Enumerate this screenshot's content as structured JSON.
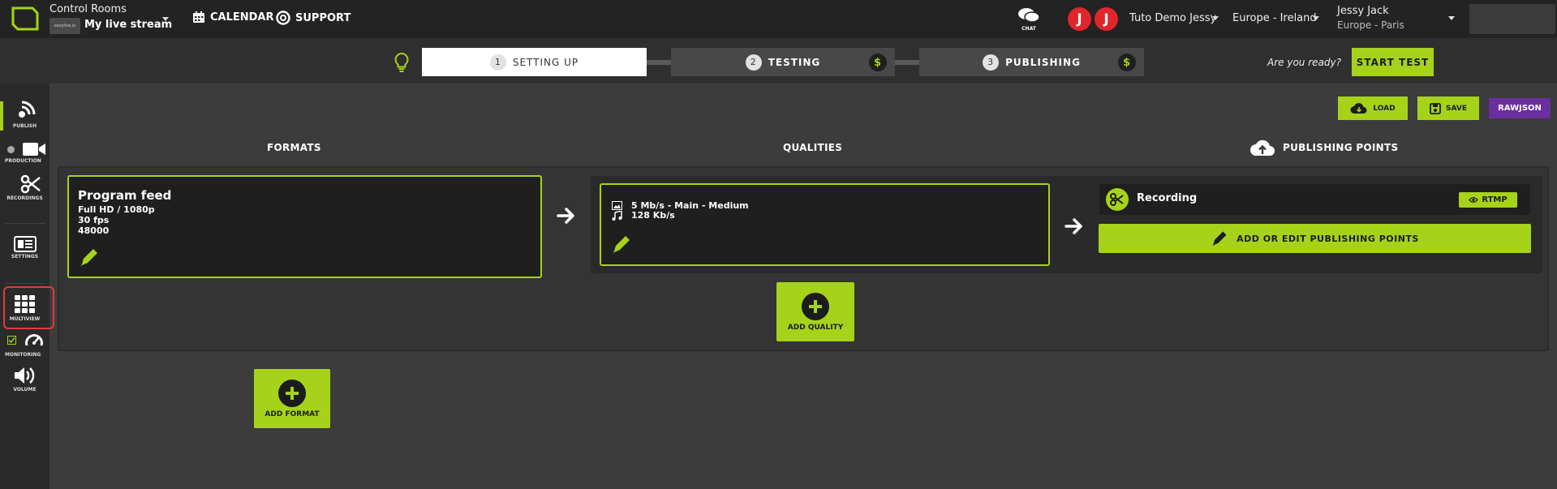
{
  "topbar": {
    "app_title": "Control Rooms",
    "stream_logo_text": "easylive.io",
    "stream_name": "My live stream",
    "calendar": "CALENDAR",
    "support": "SUPPORT",
    "chat": "CHAT",
    "avatar_1": "J",
    "avatar_2": "J",
    "workspace": "Tuto Demo Jessy",
    "region": "Europe - Ireland",
    "user_name": "Jessy Jack",
    "user_location": "Europe - Paris"
  },
  "steps": [
    {
      "num": "1",
      "label": "SETTING UP"
    },
    {
      "num": "2",
      "label": "TESTING",
      "badge": "$"
    },
    {
      "num": "3",
      "label": "PUBLISHING",
      "badge": "$"
    }
  ],
  "ready_text": "Are you ready?",
  "start_test": "START TEST",
  "sidebar": {
    "publish": "PUBLISH",
    "production": "PRODUCTION",
    "recordings": "RECORDINGS",
    "settings": "SETTINGS",
    "multiview": "MULTIVIEW",
    "monitoring": "MONITORING",
    "volume": "VOLUME"
  },
  "actions": {
    "load": "LOAD",
    "save": "SAVE",
    "rawjson": "RAWJSON"
  },
  "columns": {
    "formats": "FORMATS",
    "qualities": "QUALITIES",
    "publishing_points": "PUBLISHING POINTS"
  },
  "format": {
    "title": "Program feed",
    "resolution": "Full HD / 1080p",
    "fps": "30 fps",
    "sample_rate": "48000"
  },
  "quality": {
    "video": "5 Mb/s  -  Main  -  Medium",
    "audio": "128 Kb/s"
  },
  "publishing_point": {
    "name": "Recording",
    "protocol": "RTMP",
    "add_edit": "ADD OR EDIT PUBLISHING POINTS"
  },
  "add_quality": "ADD QUALITY",
  "add_format": "ADD FORMAT",
  "colors": {
    "accent": "#a6d31a",
    "avatar": "#e0262b",
    "rawjson": "#6b2fa0",
    "highlight": "#e23a3a"
  }
}
